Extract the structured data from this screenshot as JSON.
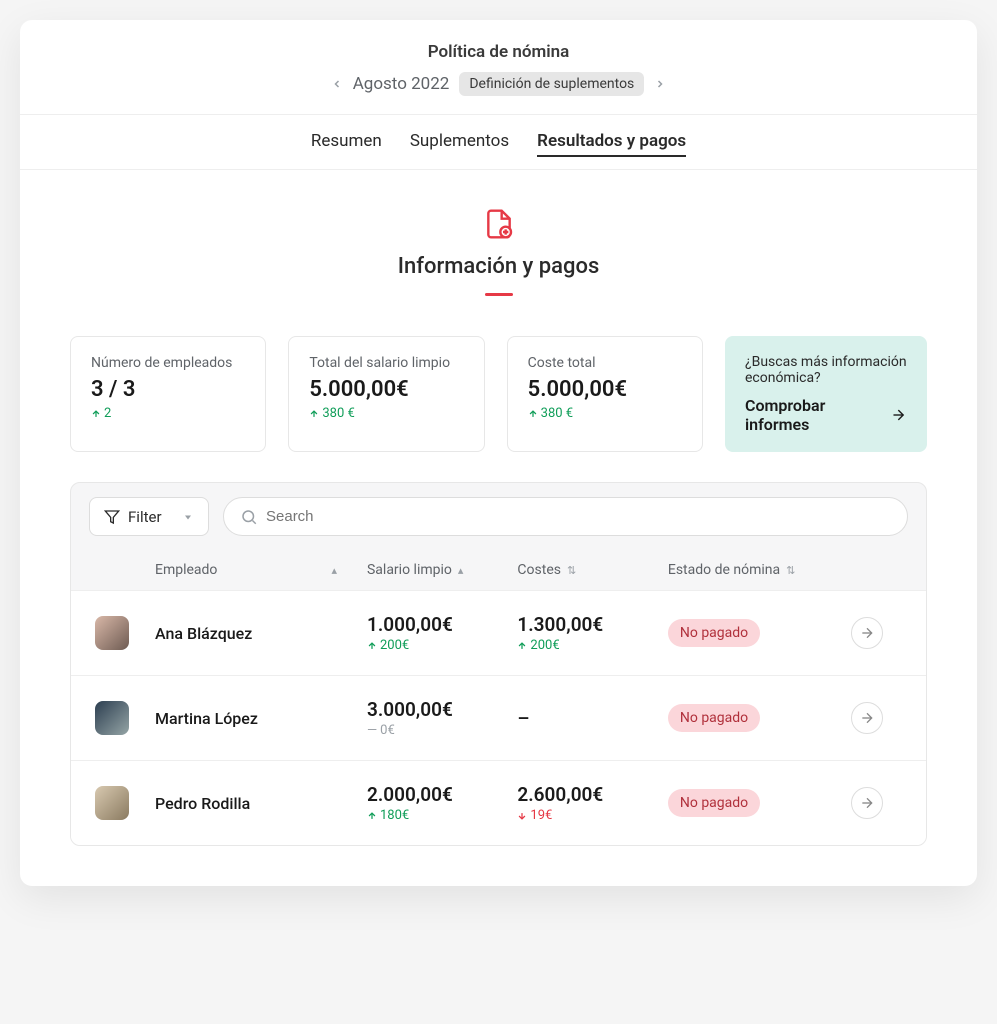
{
  "header": {
    "title": "Política de nómina",
    "period": "Agosto 2022",
    "step_badge": "Definición de suplementos"
  },
  "tabs": [
    "Resumen",
    "Suplementos",
    "Resultados y pagos"
  ],
  "active_tab_index": 2,
  "hero": {
    "title": "Información y pagos"
  },
  "stats": [
    {
      "label": "Número de empleados",
      "value": "3 / 3",
      "delta": "2",
      "delta_dir": "up"
    },
    {
      "label": "Total del salario limpio",
      "value": "5.000,00€",
      "delta": "380 €",
      "delta_dir": "up"
    },
    {
      "label": "Coste total",
      "value": "5.000,00€",
      "delta": "380 €",
      "delta_dir": "up"
    }
  ],
  "info_card": {
    "text": "¿Buscas más información económica?",
    "link": "Comprobar informes"
  },
  "controls": {
    "filter_label": "Filter",
    "search_placeholder": "Search"
  },
  "table": {
    "columns": {
      "employee": "Empleado",
      "net_salary": "Salario limpio",
      "costs": "Costes",
      "payroll_status": "Estado de nómina"
    },
    "rows": [
      {
        "name": "Ana Blázquez",
        "salary": "1.000,00€",
        "salary_delta": "200€",
        "salary_delta_dir": "up",
        "cost": "1.300,00€",
        "cost_delta": "200€",
        "cost_delta_dir": "up",
        "status": "No pagado"
      },
      {
        "name": "Martina López",
        "salary": "3.000,00€",
        "salary_delta": "0€",
        "salary_delta_dir": "neutral",
        "cost": "–",
        "cost_delta": "",
        "cost_delta_dir": "",
        "status": "No pagado"
      },
      {
        "name": "Pedro Rodilla",
        "salary": "2.000,00€",
        "salary_delta": "180€",
        "salary_delta_dir": "up",
        "cost": "2.600,00€",
        "cost_delta": "19€",
        "cost_delta_dir": "down",
        "status": "No pagado"
      }
    ]
  }
}
